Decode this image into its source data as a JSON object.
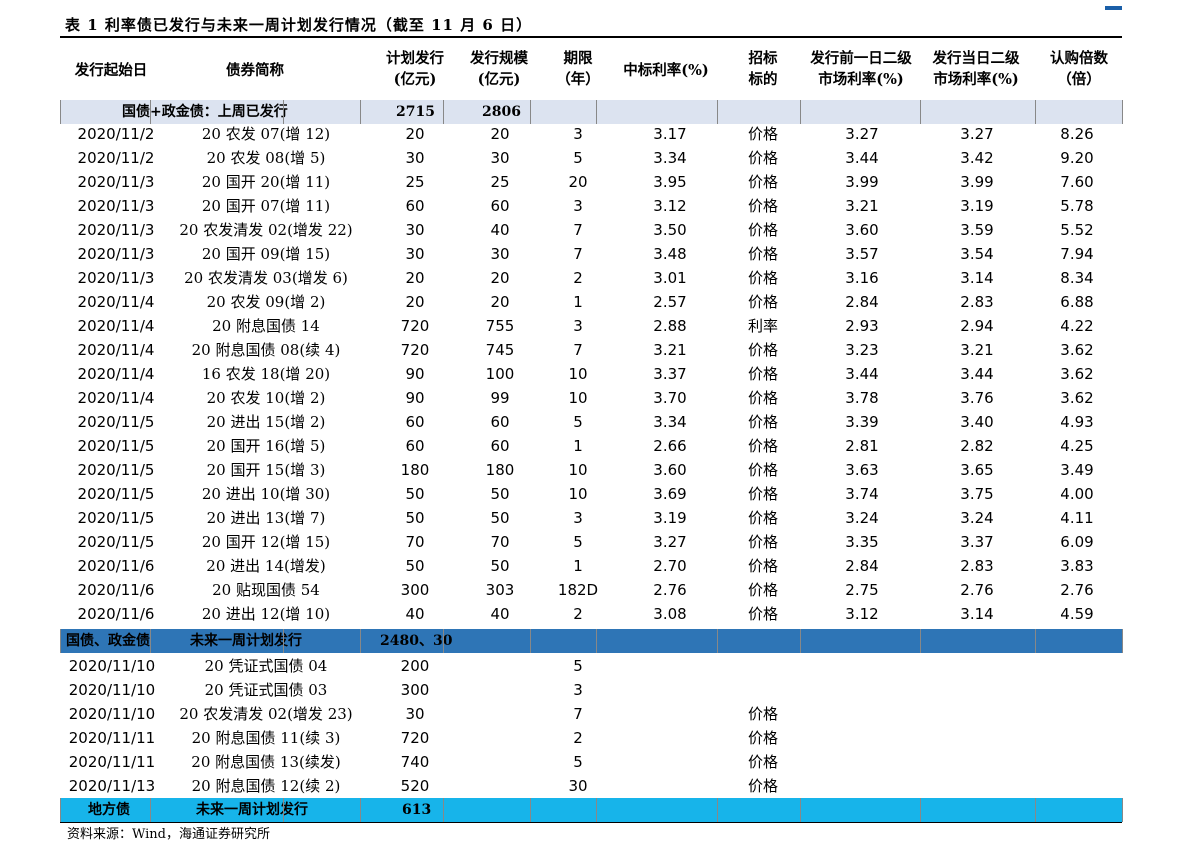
{
  "title": "表 1 利率债已发行与未来一周计划发行情况（截至 11 月 6 日）",
  "headers": {
    "start_date": "发行起始日",
    "name": "债券简称",
    "plan_l1": "计划发行",
    "plan_l2": "(亿元)",
    "scale_l1": "发行规模",
    "scale_l2": "(亿元)",
    "term_l1": "期限",
    "term_l2": "（年）",
    "rate": "中标利率(%)",
    "bid_l1": "招标",
    "bid_l2": "标的",
    "prev_l1": "发行前一日二级",
    "prev_l2": "市场利率(%)",
    "same_l1": "发行当日二级",
    "same_l2": "市场利率(%)",
    "mult_l1": "认购倍数",
    "mult_l2": "（倍）"
  },
  "section1": {
    "label": "国债+政金债：上周已发行",
    "plan": "2715",
    "scale": "2806"
  },
  "issued_rows": [
    [
      "2020/11/2",
      "20 农发 07(增 12)",
      "20",
      "20",
      "3",
      "3.17",
      "价格",
      "3.27",
      "3.27",
      "8.26"
    ],
    [
      "2020/11/2",
      "20 农发 08(增 5)",
      "30",
      "30",
      "5",
      "3.34",
      "价格",
      "3.44",
      "3.42",
      "9.20"
    ],
    [
      "2020/11/3",
      "20 国开 20(增 11)",
      "25",
      "25",
      "20",
      "3.95",
      "价格",
      "3.99",
      "3.99",
      "7.60"
    ],
    [
      "2020/11/3",
      "20 国开 07(增 11)",
      "60",
      "60",
      "3",
      "3.12",
      "价格",
      "3.21",
      "3.19",
      "5.78"
    ],
    [
      "2020/11/3",
      "20 农发清发 02(增发 22)",
      "30",
      "40",
      "7",
      "3.50",
      "价格",
      "3.60",
      "3.59",
      "5.52"
    ],
    [
      "2020/11/3",
      "20 国开 09(增 15)",
      "30",
      "30",
      "7",
      "3.48",
      "价格",
      "3.57",
      "3.54",
      "7.94"
    ],
    [
      "2020/11/3",
      "20 农发清发 03(增发 6)",
      "20",
      "20",
      "2",
      "3.01",
      "价格",
      "3.16",
      "3.14",
      "8.34"
    ],
    [
      "2020/11/4",
      "20 农发 09(增 2)",
      "20",
      "20",
      "1",
      "2.57",
      "价格",
      "2.84",
      "2.83",
      "6.88"
    ],
    [
      "2020/11/4",
      "20 附息国债 14",
      "720",
      "755",
      "3",
      "2.88",
      "利率",
      "2.93",
      "2.94",
      "4.22"
    ],
    [
      "2020/11/4",
      "20 附息国债 08(续 4)",
      "720",
      "745",
      "7",
      "3.21",
      "价格",
      "3.23",
      "3.21",
      "3.62"
    ],
    [
      "2020/11/4",
      "16 农发 18(增 20)",
      "90",
      "100",
      "10",
      "3.37",
      "价格",
      "3.44",
      "3.44",
      "3.62"
    ],
    [
      "2020/11/4",
      "20 农发 10(增 2)",
      "90",
      "99",
      "10",
      "3.70",
      "价格",
      "3.78",
      "3.76",
      "3.62"
    ],
    [
      "2020/11/5",
      "20 进出 15(增 2)",
      "60",
      "60",
      "5",
      "3.34",
      "价格",
      "3.39",
      "3.40",
      "4.93"
    ],
    [
      "2020/11/5",
      "20 国开 16(增 5)",
      "60",
      "60",
      "1",
      "2.66",
      "价格",
      "2.81",
      "2.82",
      "4.25"
    ],
    [
      "2020/11/5",
      "20 国开 15(增 3)",
      "180",
      "180",
      "10",
      "3.60",
      "价格",
      "3.63",
      "3.65",
      "3.49"
    ],
    [
      "2020/11/5",
      "20 进出 10(增 30)",
      "50",
      "50",
      "10",
      "3.69",
      "价格",
      "3.74",
      "3.75",
      "4.00"
    ],
    [
      "2020/11/5",
      "20 进出 13(增 7)",
      "50",
      "50",
      "3",
      "3.19",
      "价格",
      "3.24",
      "3.24",
      "4.11"
    ],
    [
      "2020/11/5",
      "20 国开 12(增 15)",
      "70",
      "70",
      "5",
      "3.27",
      "价格",
      "3.35",
      "3.37",
      "6.09"
    ],
    [
      "2020/11/6",
      "20 进出 14(增发)",
      "50",
      "50",
      "1",
      "2.70",
      "价格",
      "2.84",
      "2.83",
      "3.83"
    ],
    [
      "2020/11/6",
      "20 贴现国债 54",
      "300",
      "303",
      "182D",
      "2.76",
      "价格",
      "2.75",
      "2.76",
      "2.76"
    ],
    [
      "2020/11/6",
      "20 进出 12(增 10)",
      "40",
      "40",
      "2",
      "3.08",
      "价格",
      "3.12",
      "3.14",
      "4.59"
    ]
  ],
  "section2": {
    "label_a": "国债、政金债",
    "label_b": "未来一周计划发行",
    "plan": "2480、30",
    "color": "#2e75b6"
  },
  "planned_rows": [
    [
      "2020/11/10",
      "20 凭证式国债 04",
      "200",
      "",
      "5",
      "",
      "",
      "",
      "",
      ""
    ],
    [
      "2020/11/10",
      "20 凭证式国债 03",
      "300",
      "",
      "3",
      "",
      "",
      "",
      "",
      ""
    ],
    [
      "2020/11/10",
      "20 农发清发 02(增发 23)",
      "30",
      "",
      "7",
      "",
      "价格",
      "",
      "",
      ""
    ],
    [
      "2020/11/11",
      "20 附息国债 11(续 3)",
      "720",
      "",
      "2",
      "",
      "价格",
      "",
      "",
      ""
    ],
    [
      "2020/11/11",
      "20 附息国债 13(续发)",
      "740",
      "",
      "5",
      "",
      "价格",
      "",
      "",
      ""
    ],
    [
      "2020/11/13",
      "20 附息国债 12(续 2)",
      "520",
      "",
      "30",
      "",
      "价格",
      "",
      "",
      ""
    ]
  ],
  "section3": {
    "label_a": "地方债",
    "label_b": "未来一周计划发行",
    "plan": "613",
    "color": "#17b4ea"
  },
  "section1_color": "#dce3f0",
  "source": "资料来源：Wind，海通证券研究所"
}
